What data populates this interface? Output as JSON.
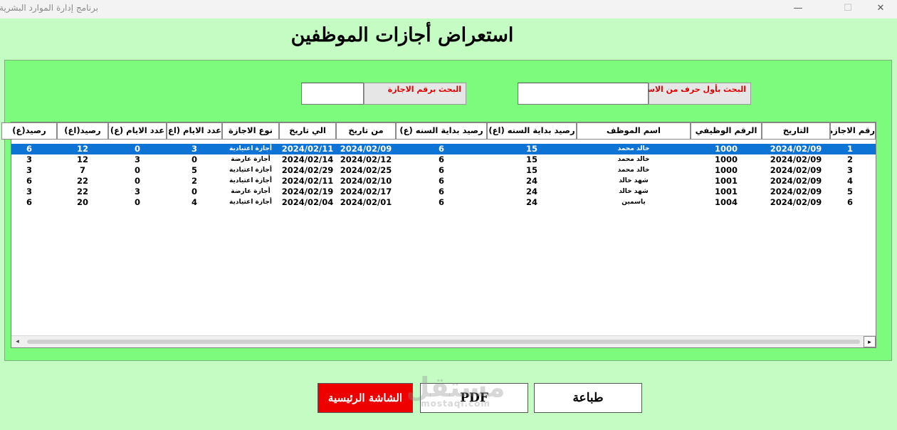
{
  "window": {
    "title": "برنامج إدارة الموارد البشرية",
    "minimize_glyph": "—",
    "maximize_glyph": "☐",
    "close_glyph": "✕"
  },
  "page": {
    "title": "استعراض أجازات الموظفين"
  },
  "search": {
    "by_name_label": "البحث بأول حرف من الاسم",
    "by_name_value": "",
    "by_leave_number_label": "البحث  برقم الاجازة",
    "by_leave_number_value": ""
  },
  "table": {
    "columns": [
      "رقم الاجازة",
      "التاريخ",
      "الرقم الوظيفي",
      "اسم الموظف",
      "رصيد بداية السنه (اع)",
      "رصيد بداية السنه (ع)",
      "من تاريخ",
      "الي تاريخ",
      "نوع الاجازة",
      "عدد الايام (اع)",
      "عدد الايام (ع)",
      "رصيد(اع)",
      "رصيد(ع)"
    ],
    "rows": [
      [
        "1",
        "2024/02/09",
        "1000",
        "خالد محمد",
        "15",
        "6",
        "2024/02/09",
        "2024/02/11",
        "أجازة اعتيادية",
        "3",
        "0",
        "12",
        "6"
      ],
      [
        "2",
        "2024/02/09",
        "1000",
        "خالد محمد",
        "15",
        "6",
        "2024/02/12",
        "2024/02/14",
        "أجازة عارضة",
        "0",
        "3",
        "12",
        "3"
      ],
      [
        "3",
        "2024/02/09",
        "1000",
        "خالد محمد",
        "15",
        "6",
        "2024/02/25",
        "2024/02/29",
        "أجازة اعتيادية",
        "5",
        "0",
        "7",
        "3"
      ],
      [
        "4",
        "2024/02/09",
        "1001",
        "شهد خالد",
        "24",
        "6",
        "2024/02/10",
        "2024/02/11",
        "أجازة اعتيادية",
        "2",
        "0",
        "22",
        "6"
      ],
      [
        "5",
        "2024/02/09",
        "1001",
        "شهد خالد",
        "24",
        "6",
        "2024/02/17",
        "2024/02/19",
        "أجازة عارضة",
        "0",
        "3",
        "22",
        "3"
      ],
      [
        "6",
        "2024/02/09",
        "1004",
        "ياسمين",
        "24",
        "6",
        "2024/02/01",
        "2024/02/04",
        "أجازة اعتيادية",
        "4",
        "0",
        "20",
        "6"
      ]
    ],
    "selected_row": 0
  },
  "scrollbar": {
    "left_glyph": "◂",
    "right_glyph": "▸"
  },
  "buttons": {
    "print": "طباعة",
    "pdf": "PDF",
    "home": "الشاشة الرئيسية"
  },
  "watermark": {
    "main": "مستقل",
    "sub": "mostaql.com"
  },
  "colors": {
    "background": "#c4fcc4",
    "panel": "#7dfb7d",
    "selection": "#0d74d6",
    "home_button": "#ee0000",
    "search_label_text": "#e00000"
  }
}
